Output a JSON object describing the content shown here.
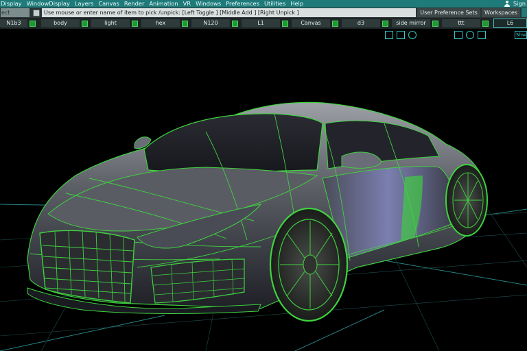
{
  "menu": {
    "items": [
      "Display",
      "WindowDisplay",
      "Layers",
      "Canvas",
      "Render",
      "Animation",
      "VR",
      "Windows",
      "Preferences",
      "Utilities",
      "Help"
    ],
    "sign_label": "Sign"
  },
  "prompt": {
    "search_value": "ect",
    "message": "Use mouse or enter name of item to pick /unpick: [Left Toggle ] [Middle Add ] [Right Unpick ]"
  },
  "toolbar": {
    "user_preference_sets": "User Preference Sets",
    "workspaces": "Workspaces"
  },
  "layers": [
    {
      "label": "N1b3"
    },
    {
      "label": "body"
    },
    {
      "label": "light"
    },
    {
      "label": "hex"
    },
    {
      "label": "N120"
    },
    {
      "label": "L1"
    },
    {
      "label": "Canvas"
    },
    {
      "label": "d3"
    },
    {
      "label": "side mirror"
    },
    {
      "label": "ttt"
    }
  ],
  "active_layer": "L6",
  "viewport": {
    "show_label": "Shw",
    "colors": {
      "wireframe": "#3fd23f",
      "grid": "#2fa5a5",
      "background": "#000000"
    }
  }
}
